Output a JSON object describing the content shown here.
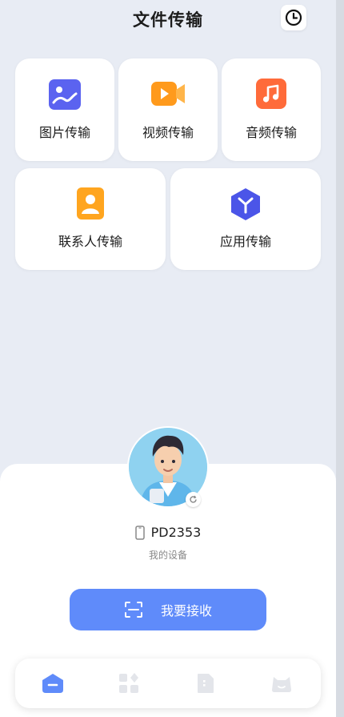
{
  "header": {
    "title": "文件传输"
  },
  "categories": [
    {
      "label": "图片传输",
      "icon": "image-icon",
      "color": "#5b63f0"
    },
    {
      "label": "视频传输",
      "icon": "video-icon",
      "color": "#ff9a1c"
    },
    {
      "label": "音频传输",
      "icon": "music-icon",
      "color": "#ff6b3a"
    },
    {
      "label": "联系人传输",
      "icon": "contact-icon",
      "color": "#ffa51f"
    },
    {
      "label": "应用传输",
      "icon": "app-icon",
      "color": "#4b55e8"
    }
  ],
  "device": {
    "name": "PD2353",
    "subtitle": "我的设备"
  },
  "receive_button": {
    "label": "我要接收"
  },
  "tabs": [
    {
      "name": "home-tab",
      "icon": "home-icon",
      "active": true
    },
    {
      "name": "apps-tab",
      "icon": "apps-grid-icon",
      "active": false
    },
    {
      "name": "files-tab",
      "icon": "file-icon",
      "active": false
    },
    {
      "name": "profile-tab",
      "icon": "profile-icon",
      "active": false
    }
  ],
  "colors": {
    "accent": "#5f8bfa",
    "background": "#e8ecf4",
    "tab_inactive": "#e3e5ea"
  }
}
